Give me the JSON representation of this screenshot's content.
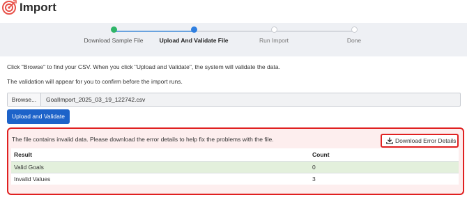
{
  "header": {
    "title": "Import",
    "logo_icon": "target-icon"
  },
  "stepper": {
    "steps": [
      {
        "label": "Download Sample File",
        "state": "complete"
      },
      {
        "label": "Upload And Validate File",
        "state": "active"
      },
      {
        "label": "Run Import",
        "state": "pending"
      },
      {
        "label": "Done",
        "state": "pending"
      }
    ]
  },
  "instructions": {
    "line1": "Click \"Browse\" to find your CSV. When you click \"Upload and Validate\", the system will validate the data.",
    "line2": "The validation will appear for you to confirm before the import runs."
  },
  "file": {
    "browse_label": "Browse...",
    "file_name": "GoalImport_2025_03_19_122742.csv"
  },
  "upload_button": "Upload and Validate",
  "validation": {
    "message": "The file contains invalid data. Please download the error details to help fix the problems with the file.",
    "download_label": "Download Error Details",
    "download_icon": "download-icon",
    "columns": [
      "Result",
      "Count"
    ],
    "rows": [
      {
        "result": "Valid Goals",
        "count": "0"
      },
      {
        "result": "Invalid Values",
        "count": "3"
      }
    ]
  },
  "colors": {
    "accent": "#1d63c9",
    "error": "#e02020",
    "complete": "#2fb568",
    "valid_row": "#e3f0dc"
  }
}
